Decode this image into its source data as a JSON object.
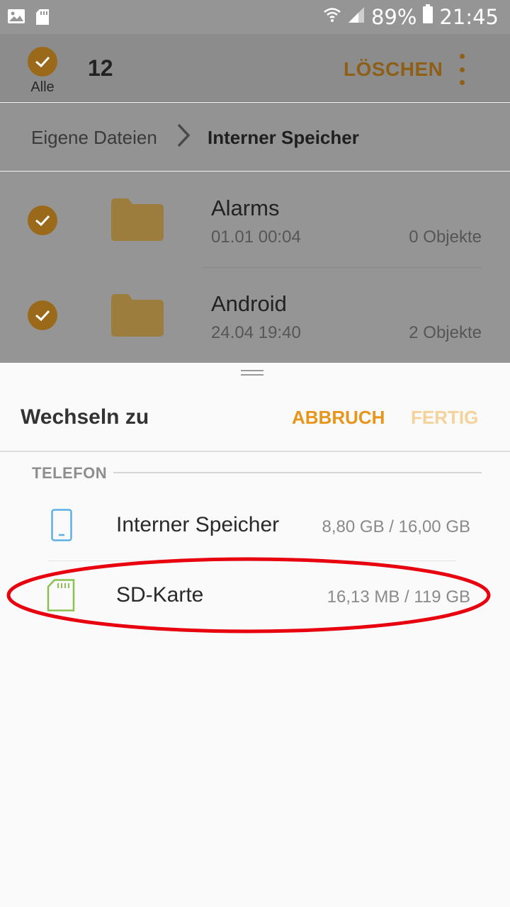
{
  "status_bar": {
    "battery": "89%",
    "time": "21:45",
    "icons": [
      "image-icon",
      "sd-card-icon",
      "wifi-icon",
      "signal-icon",
      "battery-icon"
    ]
  },
  "action_bar": {
    "select_all_label": "Alle",
    "selected_count": "12",
    "delete_label": "LÖSCHEN",
    "accent_color": "#8e5f17"
  },
  "breadcrumb": {
    "home": "Eigene Dateien",
    "current": "Interner Speicher"
  },
  "files": [
    {
      "name": "Alarms",
      "date": "01.01 00:04",
      "count": "0 Objekte"
    },
    {
      "name": "Android",
      "date": "24.04 19:40",
      "count": "2 Objekte"
    }
  ],
  "sheet": {
    "title": "Wechseln zu",
    "cancel_label": "ABBRUCH",
    "done_label": "FERTIG",
    "section_label": "TELEFON",
    "accent_color": "#e8951c",
    "storage": [
      {
        "name": "Interner Speicher",
        "size": "8,80 GB / 16,00 GB",
        "icon": "phone-icon"
      },
      {
        "name": "SD-Karte",
        "size": "16,13 MB / 119 GB",
        "icon": "sd-card-icon"
      }
    ]
  },
  "annotation_color": "#e8000e"
}
